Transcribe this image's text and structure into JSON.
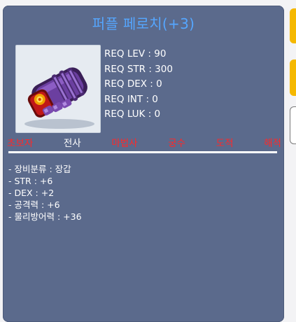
{
  "item": {
    "name": "퍼플 페로치(+3)",
    "icon": "purple-gauntlet-icon"
  },
  "requirements": [
    "REQ LEV : 90",
    "REQ STR : 300",
    "REQ DEX : 0",
    "REQ INT : 0",
    "REQ LUK : 0"
  ],
  "jobs": [
    {
      "label": "초보자",
      "allowed": false
    },
    {
      "label": "전사",
      "allowed": true
    },
    {
      "label": "마법사",
      "allowed": false
    },
    {
      "label": "궁수",
      "allowed": false
    },
    {
      "label": "도적",
      "allowed": false
    },
    {
      "label": "해적",
      "allowed": false
    }
  ],
  "stats": [
    "- 장비분류 : 장갑",
    "- STR : +6",
    "- DEX : +2",
    "- 공격력 : +6",
    "- 물리방어력 : +36"
  ],
  "colors": {
    "panel": "#5b6a8c",
    "title": "#55a6ff",
    "job_disallowed": "#ff2828",
    "job_allowed": "#ffffff",
    "side_tab": "#f5b800"
  }
}
